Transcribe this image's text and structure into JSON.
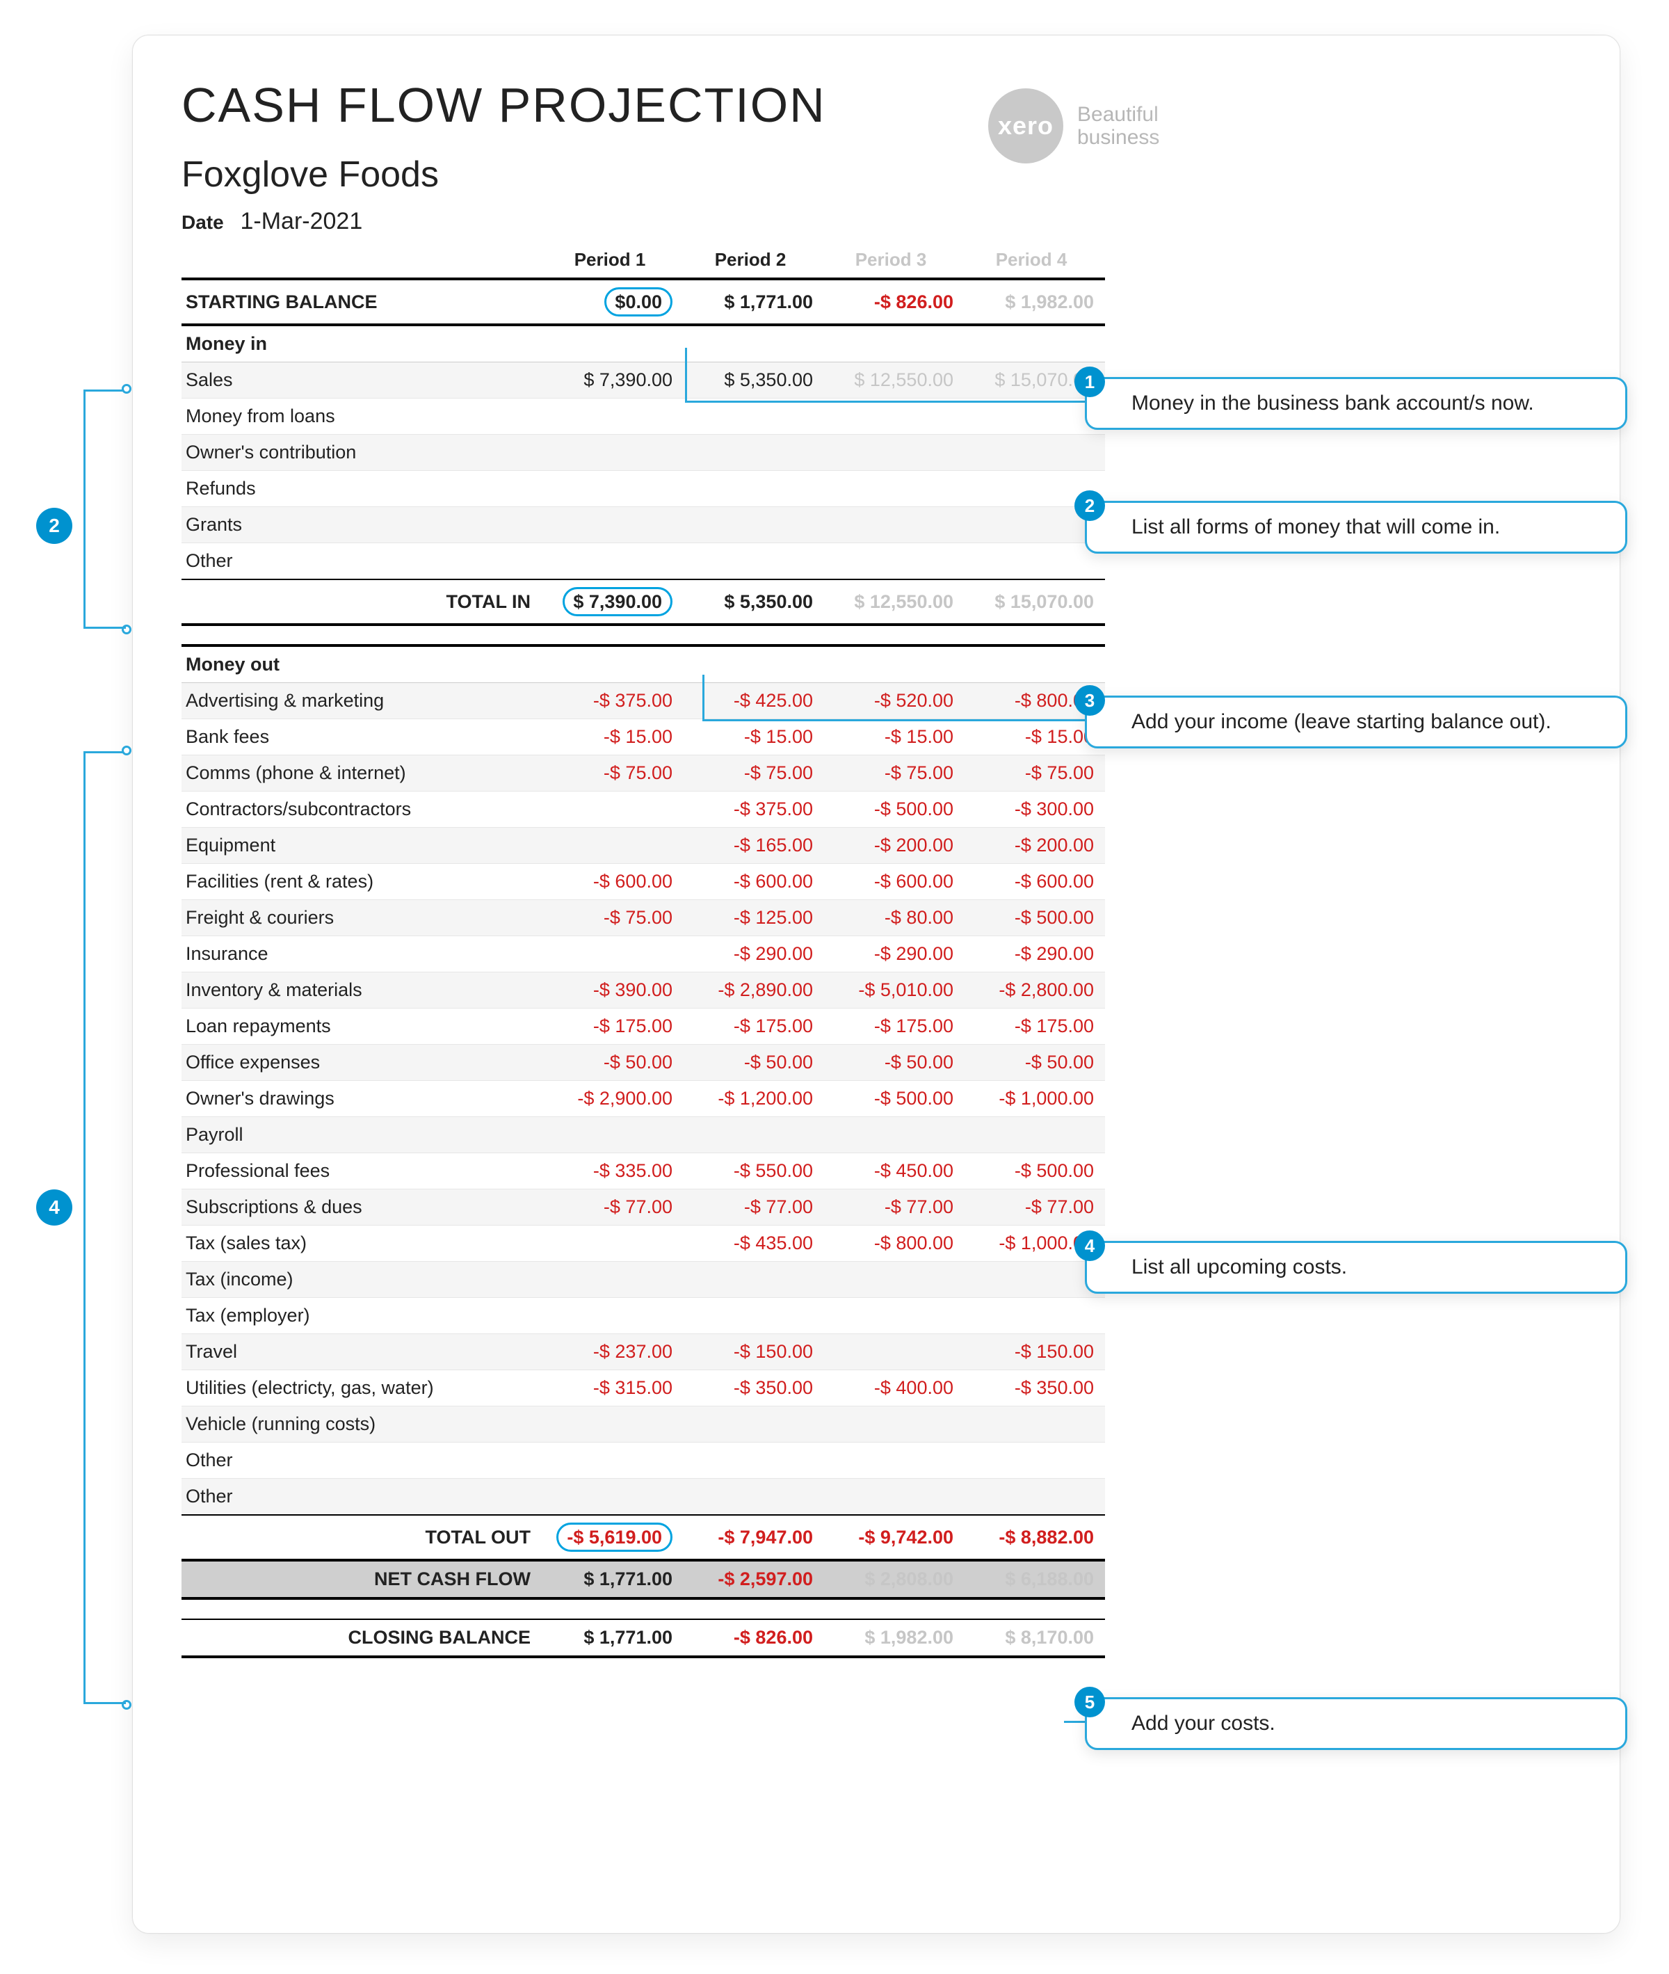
{
  "brand": {
    "logo_text": "xero",
    "tagline1": "Beautiful",
    "tagline2": "business"
  },
  "header": {
    "title": "CASH FLOW PROJECTION",
    "company": "Foxglove Foods",
    "date_label": "Date",
    "date_value": "1-Mar-2021"
  },
  "columns": [
    "Period 1",
    "Period 2",
    "Period 3",
    "Period 4"
  ],
  "starting_balance": {
    "label": "STARTING BALANCE",
    "values": [
      "$0.00",
      "$ 1,771.00",
      "-$ 826.00",
      "$ 1,982.00"
    ]
  },
  "money_in": {
    "heading": "Money in",
    "rows": [
      {
        "label": "Sales",
        "values": [
          "$ 7,390.00",
          "$ 5,350.00",
          "$ 12,550.00",
          "$ 15,070.00"
        ]
      },
      {
        "label": "Money from loans",
        "values": [
          "",
          "",
          "",
          ""
        ]
      },
      {
        "label": "Owner's contribution",
        "values": [
          "",
          "",
          "",
          ""
        ]
      },
      {
        "label": "Refunds",
        "values": [
          "",
          "",
          "",
          ""
        ]
      },
      {
        "label": "Grants",
        "values": [
          "",
          "",
          "",
          ""
        ]
      },
      {
        "label": "Other",
        "values": [
          "",
          "",
          "",
          ""
        ]
      }
    ],
    "total": {
      "label": "TOTAL IN",
      "values": [
        "$ 7,390.00",
        "$ 5,350.00",
        "$ 12,550.00",
        "$ 15,070.00"
      ]
    }
  },
  "money_out": {
    "heading": "Money out",
    "rows": [
      {
        "label": "Advertising & marketing",
        "values": [
          "-$ 375.00",
          "-$ 425.00",
          "-$ 520.00",
          "-$ 800.00"
        ]
      },
      {
        "label": "Bank fees",
        "values": [
          "-$ 15.00",
          "-$ 15.00",
          "-$ 15.00",
          "-$ 15.00"
        ]
      },
      {
        "label": "Comms (phone & internet)",
        "values": [
          "-$ 75.00",
          "-$ 75.00",
          "-$ 75.00",
          "-$ 75.00"
        ]
      },
      {
        "label": "Contractors/subcontractors",
        "values": [
          "",
          "-$ 375.00",
          "-$ 500.00",
          "-$ 300.00"
        ]
      },
      {
        "label": "Equipment",
        "values": [
          "",
          "-$ 165.00",
          "-$ 200.00",
          "-$ 200.00"
        ]
      },
      {
        "label": "Facilities (rent & rates)",
        "values": [
          "-$ 600.00",
          "-$ 600.00",
          "-$ 600.00",
          "-$ 600.00"
        ]
      },
      {
        "label": "Freight & couriers",
        "values": [
          "-$ 75.00",
          "-$ 125.00",
          "-$ 80.00",
          "-$ 500.00"
        ]
      },
      {
        "label": "Insurance",
        "values": [
          "",
          "-$ 290.00",
          "-$ 290.00",
          "-$ 290.00"
        ]
      },
      {
        "label": "Inventory & materials",
        "values": [
          "-$ 390.00",
          "-$ 2,890.00",
          "-$ 5,010.00",
          "-$ 2,800.00"
        ]
      },
      {
        "label": "Loan repayments",
        "values": [
          "-$ 175.00",
          "-$ 175.00",
          "-$ 175.00",
          "-$ 175.00"
        ]
      },
      {
        "label": "Office expenses",
        "values": [
          "-$ 50.00",
          "-$ 50.00",
          "-$ 50.00",
          "-$ 50.00"
        ]
      },
      {
        "label": "Owner's drawings",
        "values": [
          "-$ 2,900.00",
          "-$ 1,200.00",
          "-$ 500.00",
          "-$ 1,000.00"
        ]
      },
      {
        "label": "Payroll",
        "values": [
          "",
          "",
          "",
          ""
        ]
      },
      {
        "label": "Professional fees",
        "values": [
          "-$ 335.00",
          "-$ 550.00",
          "-$ 450.00",
          "-$ 500.00"
        ]
      },
      {
        "label": "Subscriptions & dues",
        "values": [
          "-$ 77.00",
          "-$ 77.00",
          "-$ 77.00",
          "-$ 77.00"
        ]
      },
      {
        "label": "Tax (sales tax)",
        "values": [
          "",
          "-$ 435.00",
          "-$ 800.00",
          "-$ 1,000.00"
        ]
      },
      {
        "label": "Tax (income)",
        "values": [
          "",
          "",
          "",
          ""
        ]
      },
      {
        "label": "Tax (employer)",
        "values": [
          "",
          "",
          "",
          ""
        ]
      },
      {
        "label": "Travel",
        "values": [
          "-$ 237.00",
          "-$ 150.00",
          "",
          "-$ 150.00"
        ]
      },
      {
        "label": "Utilities (electricty, gas, water)",
        "values": [
          "-$ 315.00",
          "-$ 350.00",
          "-$ 400.00",
          "-$ 350.00"
        ]
      },
      {
        "label": "Vehicle (running costs)",
        "values": [
          "",
          "",
          "",
          ""
        ]
      },
      {
        "label": "Other",
        "values": [
          "",
          "",
          "",
          ""
        ]
      },
      {
        "label": "Other",
        "values": [
          "",
          "",
          "",
          ""
        ]
      }
    ],
    "total": {
      "label": "TOTAL OUT",
      "values": [
        "-$ 5,619.00",
        "-$ 7,947.00",
        "-$ 9,742.00",
        "-$ 8,882.00"
      ]
    }
  },
  "net_cash_flow": {
    "label": "NET CASH FLOW",
    "values": [
      "$ 1,771.00",
      "-$ 2,597.00",
      "$ 2,808.00",
      "$ 6,188.00"
    ]
  },
  "closing_balance": {
    "label": "CLOSING BALANCE",
    "values": [
      "$ 1,771.00",
      "-$ 826.00",
      "$ 1,982.00",
      "$ 8,170.00"
    ]
  },
  "callouts": {
    "c1": "Money in the business bank account/s now.",
    "c2": "List all forms of money that will come in.",
    "c3": "Add your income (leave starting balance out).",
    "c4": "List all upcoming costs.",
    "c5": "Add your costs."
  }
}
